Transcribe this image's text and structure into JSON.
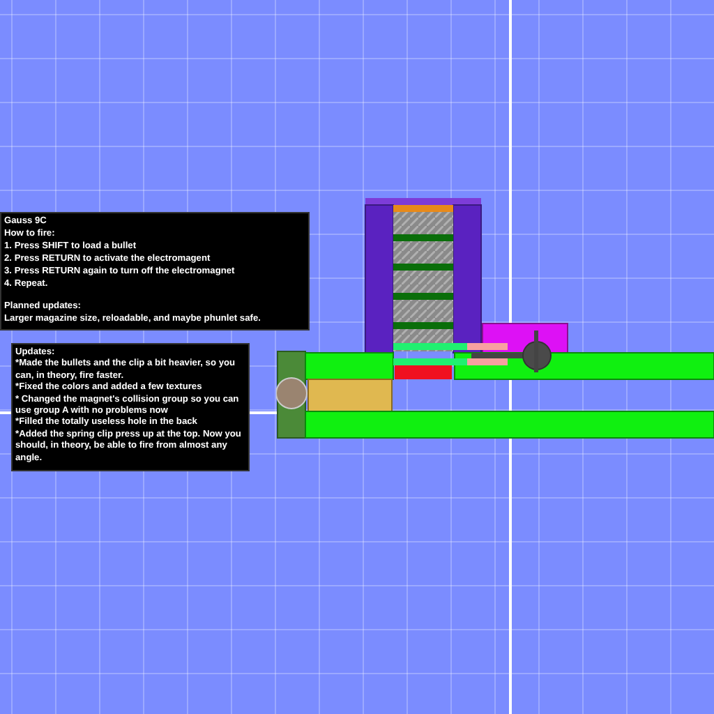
{
  "instructions_panel": {
    "sections": [
      [
        "Gauss 9C",
        "How to fire:",
        "1. Press SHIFT to load a bullet",
        "2. Press RETURN to activate the electromagent",
        "3. Press RETURN again to turn off the electromagnet",
        "4. Repeat."
      ],
      [
        "Planned updates:",
        "Larger magazine size, reloadable, and maybe phunlet safe."
      ]
    ]
  },
  "updates_panel": {
    "lines": [
      "Updates:",
      "*Made the bullets and the clip a bit heavier, so you can, in theory, fire faster.",
      "*Fixed the colors and added a few textures",
      "* Changed the magnet's collision group so you can use group A with no problems now",
      "*Filled the totally useless hole in the back",
      "*Added the spring clip press up at the top. Now you should, in theory, be able to fire from almost any angle."
    ]
  }
}
